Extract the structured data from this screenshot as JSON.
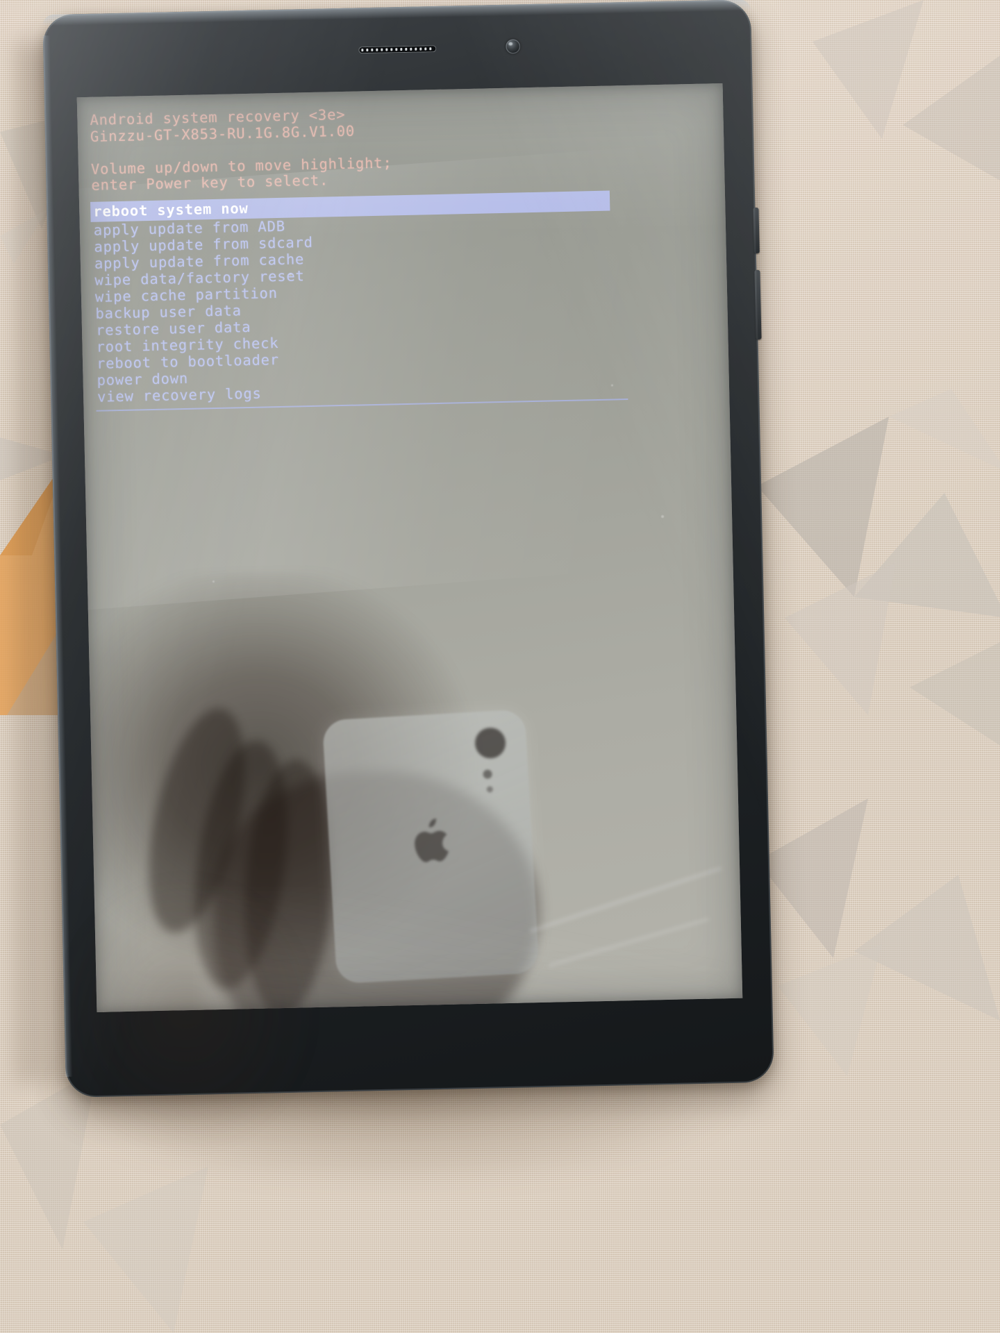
{
  "device": {
    "kind": "android-tablet",
    "hardware": {
      "earpiece_speaker": "speaker-grille",
      "front_camera": "front-camera",
      "side_button": "power-button"
    }
  },
  "screen": {
    "mode": "android-system-recovery",
    "header": [
      "Android system recovery <3e>",
      "Ginzzu-GT-X853-RU.1G.8G.V1.00"
    ],
    "instructions": [
      "Volume up/down to move highlight;",
      "enter Power key to select."
    ],
    "menu": {
      "selected_index": 0,
      "items": [
        "reboot system now",
        "apply update from ADB",
        "apply update from sdcard",
        "apply update from cache",
        "wipe data/factory reset",
        "wipe cache partition",
        "backup user data",
        "restore user data",
        "root integrity check",
        "reboot to bootloader",
        "power down",
        "view recovery logs"
      ]
    }
  },
  "colors": {
    "header_text": "#e8b8ad",
    "menu_text": "#b9c2ee",
    "selection_bg": "#b3bbe8",
    "selection_text": "#ffffff",
    "screen_bg": "#a3a49c",
    "bezel": "#24282b",
    "divider": "#a9b3e2"
  }
}
